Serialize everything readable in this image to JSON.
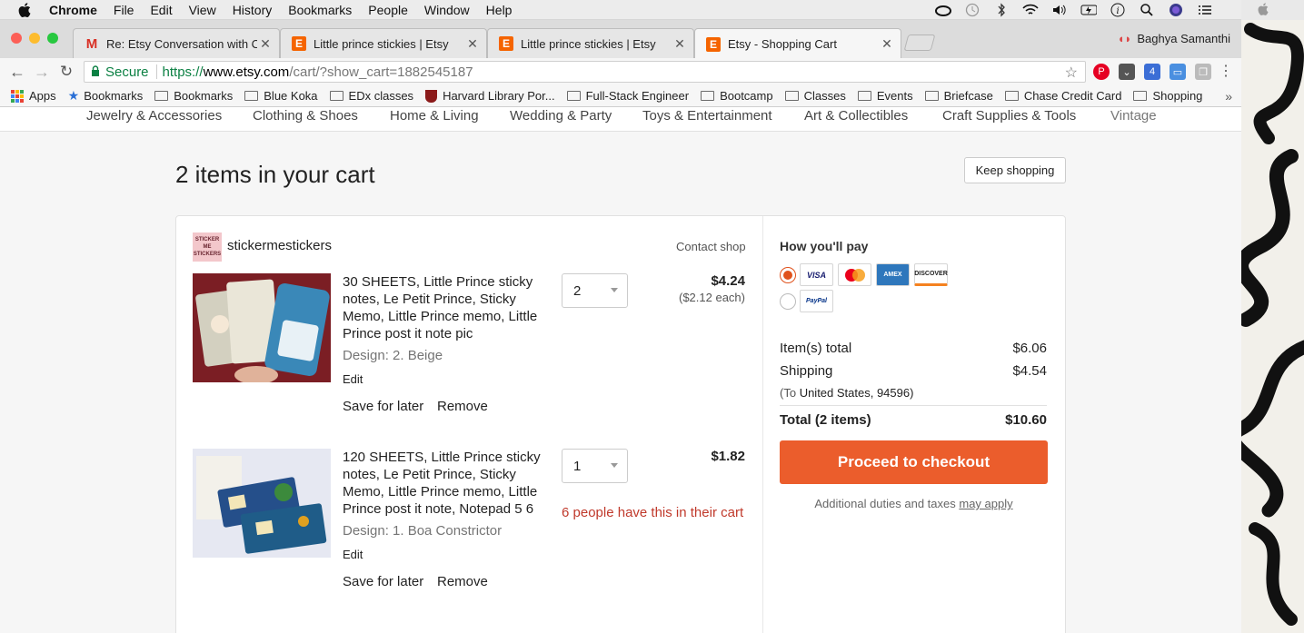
{
  "mac_menu": {
    "app": "Chrome",
    "items": [
      "File",
      "Edit",
      "View",
      "History",
      "Bookmarks",
      "People",
      "Window",
      "Help"
    ]
  },
  "tabs": [
    {
      "title": "Re: Etsy Conversation with Cat",
      "icon": "gmail-icon",
      "active": false
    },
    {
      "title": "Little prince stickies | Etsy",
      "icon": "etsy-icon",
      "active": false
    },
    {
      "title": "Little prince stickies | Etsy",
      "icon": "etsy-icon",
      "active": false
    },
    {
      "title": "Etsy - Shopping Cart",
      "icon": "etsy-icon",
      "active": true
    }
  ],
  "profile_name": "Baghya Samanthi",
  "address": {
    "secure_label": "Secure",
    "scheme": "https://",
    "host": "www.etsy.com",
    "path": "/cart/?show_cart=1882545187"
  },
  "bookmarks": [
    {
      "label": "Apps",
      "kind": "apps"
    },
    {
      "label": "Bookmarks",
      "kind": "star"
    },
    {
      "label": "Bookmarks",
      "kind": "folder"
    },
    {
      "label": "Blue Koka",
      "kind": "folder"
    },
    {
      "label": "EDx classes",
      "kind": "folder"
    },
    {
      "label": "Harvard Library Por...",
      "kind": "shield"
    },
    {
      "label": "Full-Stack Engineer",
      "kind": "folder"
    },
    {
      "label": "Bootcamp",
      "kind": "folder"
    },
    {
      "label": "Classes",
      "kind": "folder"
    },
    {
      "label": "Events",
      "kind": "folder"
    },
    {
      "label": "Briefcase",
      "kind": "folder"
    },
    {
      "label": "Chase Credit Card",
      "kind": "folder"
    },
    {
      "label": "Shopping",
      "kind": "folder"
    }
  ],
  "categories": [
    "Jewelry & Accessories",
    "Clothing & Shoes",
    "Home & Living",
    "Wedding & Party",
    "Toys & Entertainment",
    "Art & Collectibles",
    "Craft Supplies & Tools",
    "Vintage"
  ],
  "cart": {
    "heading": "2 items in your cart",
    "keep_shopping": "Keep shopping",
    "shop_name": "stickermestickers",
    "shop_logo_text": "STICKER ME STICKERS",
    "contact_shop": "Contact shop",
    "items": [
      {
        "title": "30 SHEETS, Little Prince sticky notes, Le Petit Prince, Sticky Memo, Little Prince memo, Little Prince post it note pic",
        "design": "Design: 2. Beige",
        "edit": "Edit",
        "save_for_later": "Save for later",
        "remove": "Remove",
        "quantity": "2",
        "price": "$4.24",
        "price_each": "($2.12 each)"
      },
      {
        "title": "120 SHEETS, Little Prince sticky notes, Le Petit Prince, Sticky Memo, Little Prince memo, Little Prince post it note, Notepad 5 6",
        "design": "Design: 1. Boa Constrictor",
        "edit": "Edit",
        "save_for_later": "Save for later",
        "remove": "Remove",
        "quantity": "1",
        "price": "$1.82",
        "demand": "6 people have this in their cart"
      }
    ]
  },
  "payment": {
    "heading": "How you'll pay",
    "cards": [
      "VISA",
      "mastercard",
      "AMEX",
      "DISCOVER"
    ],
    "paypal": "PayPal",
    "items_total_label": "Item(s) total",
    "items_total_value": "$6.06",
    "shipping_label": "Shipping",
    "shipping_value": "$4.54",
    "ship_to_prefix": "(To",
    "ship_to_place": "United States, 94596)",
    "total_label": "Total (2 items)",
    "total_value": "$10.60",
    "checkout_label": "Proceed to checkout",
    "duties_text": "Additional duties and taxes",
    "duties_link": "may apply"
  },
  "colors": {
    "etsy_orange": "#f56400",
    "checkout_orange": "#eb5d2c",
    "demand_red": "#c0392b",
    "secure_green": "#0b8043"
  }
}
